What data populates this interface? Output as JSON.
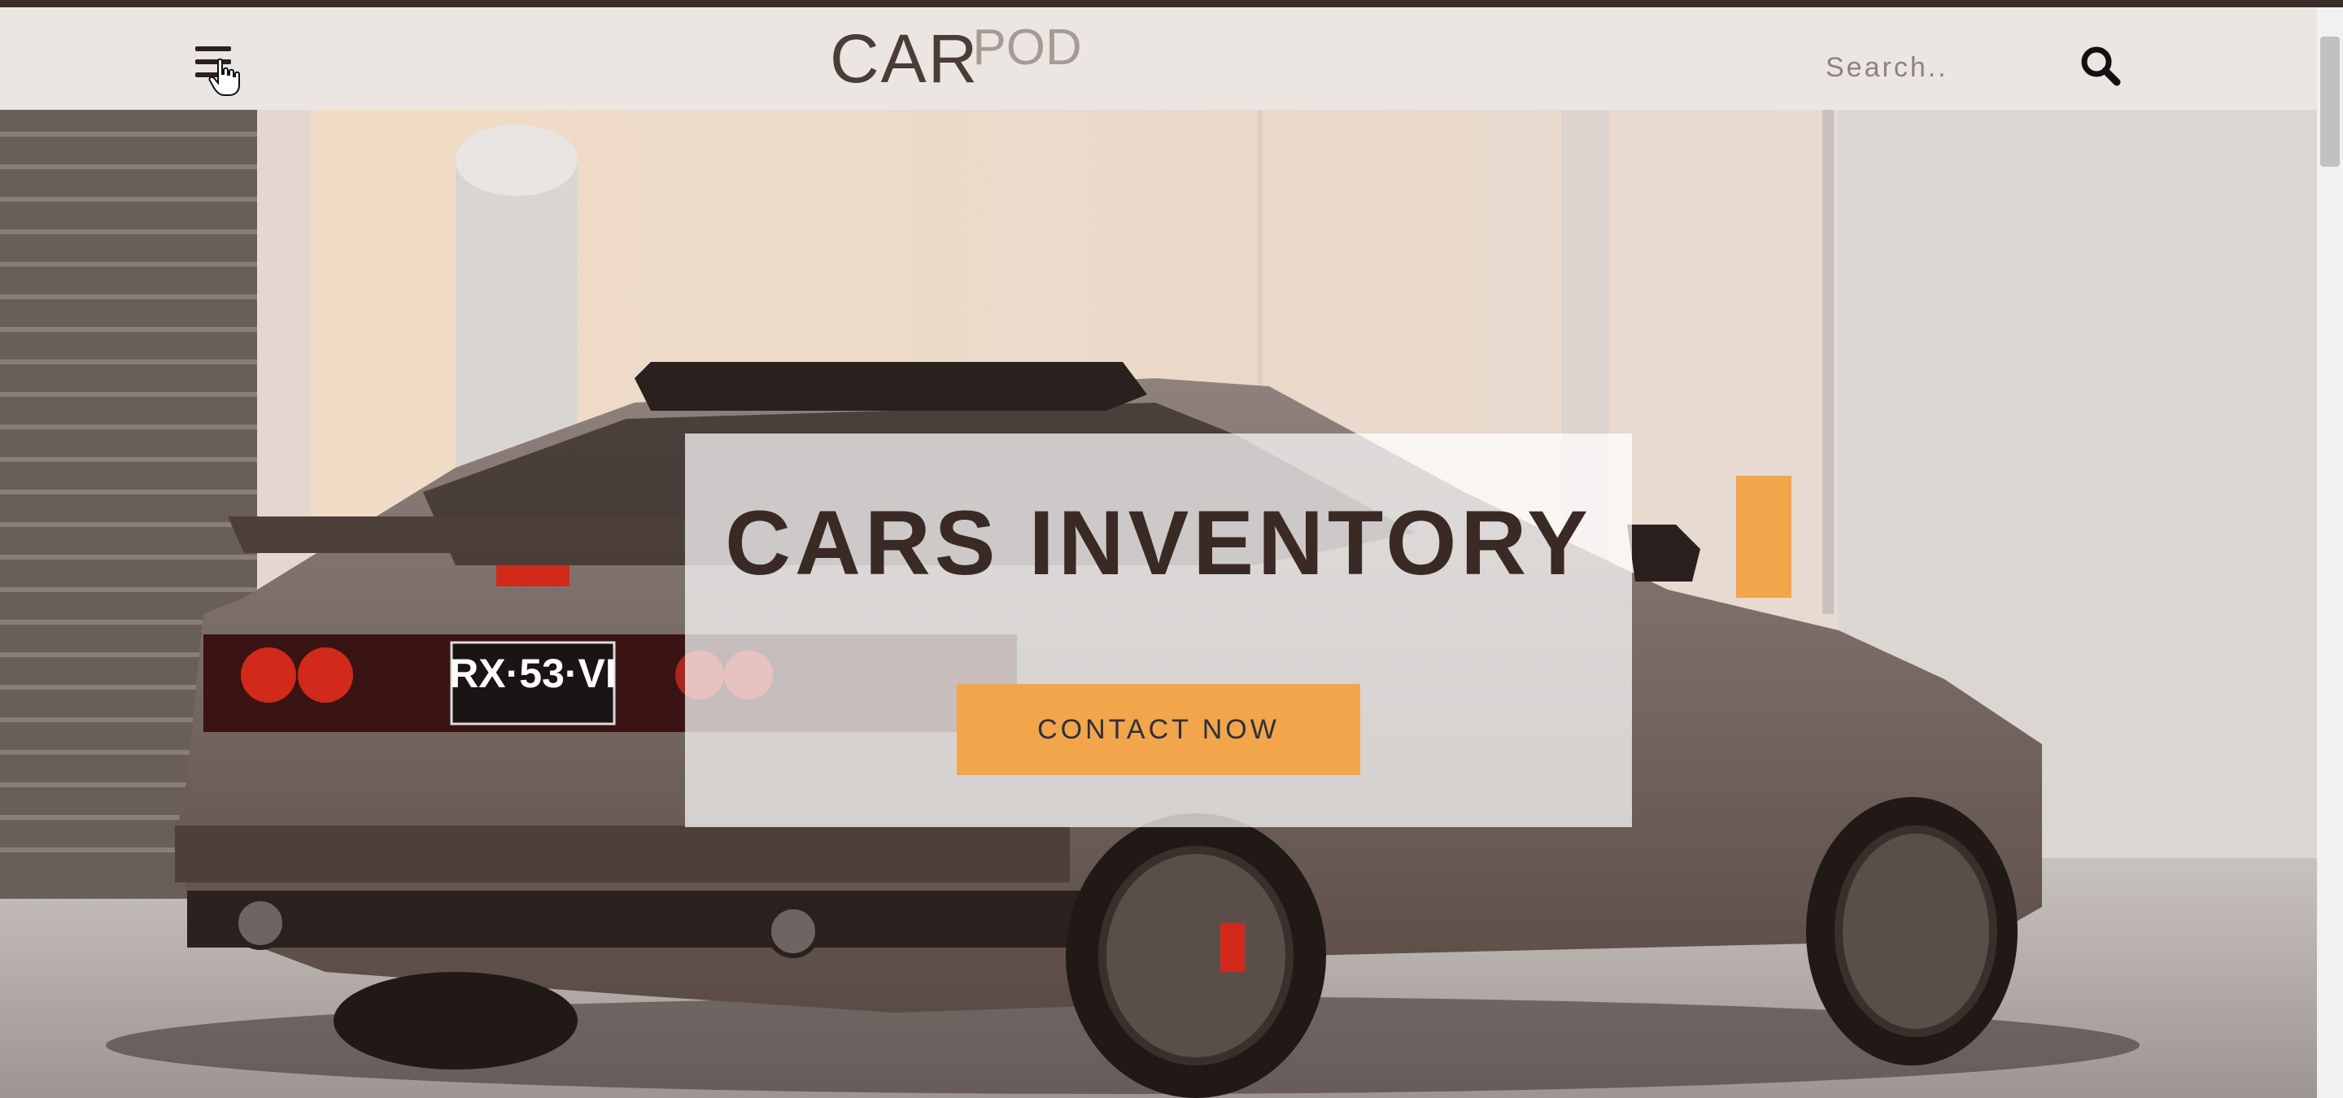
{
  "header": {
    "logo_main": "CAR",
    "logo_sub": "POD",
    "search_placeholder": "Search.."
  },
  "hero": {
    "title": "CARS INVENTORY",
    "cta_label": "CONTACT NOW",
    "license_plate": "RX·53·VI"
  },
  "colors": {
    "header_bg": "#ece6e3",
    "top_strip": "#3a2e29",
    "accent": "#f2a54a",
    "title_text": "#3a2a25",
    "cta_text": "#2c3040"
  },
  "icons": {
    "menu": "hamburger-icon",
    "cursor": "hand-pointer-icon",
    "search": "search-icon"
  }
}
